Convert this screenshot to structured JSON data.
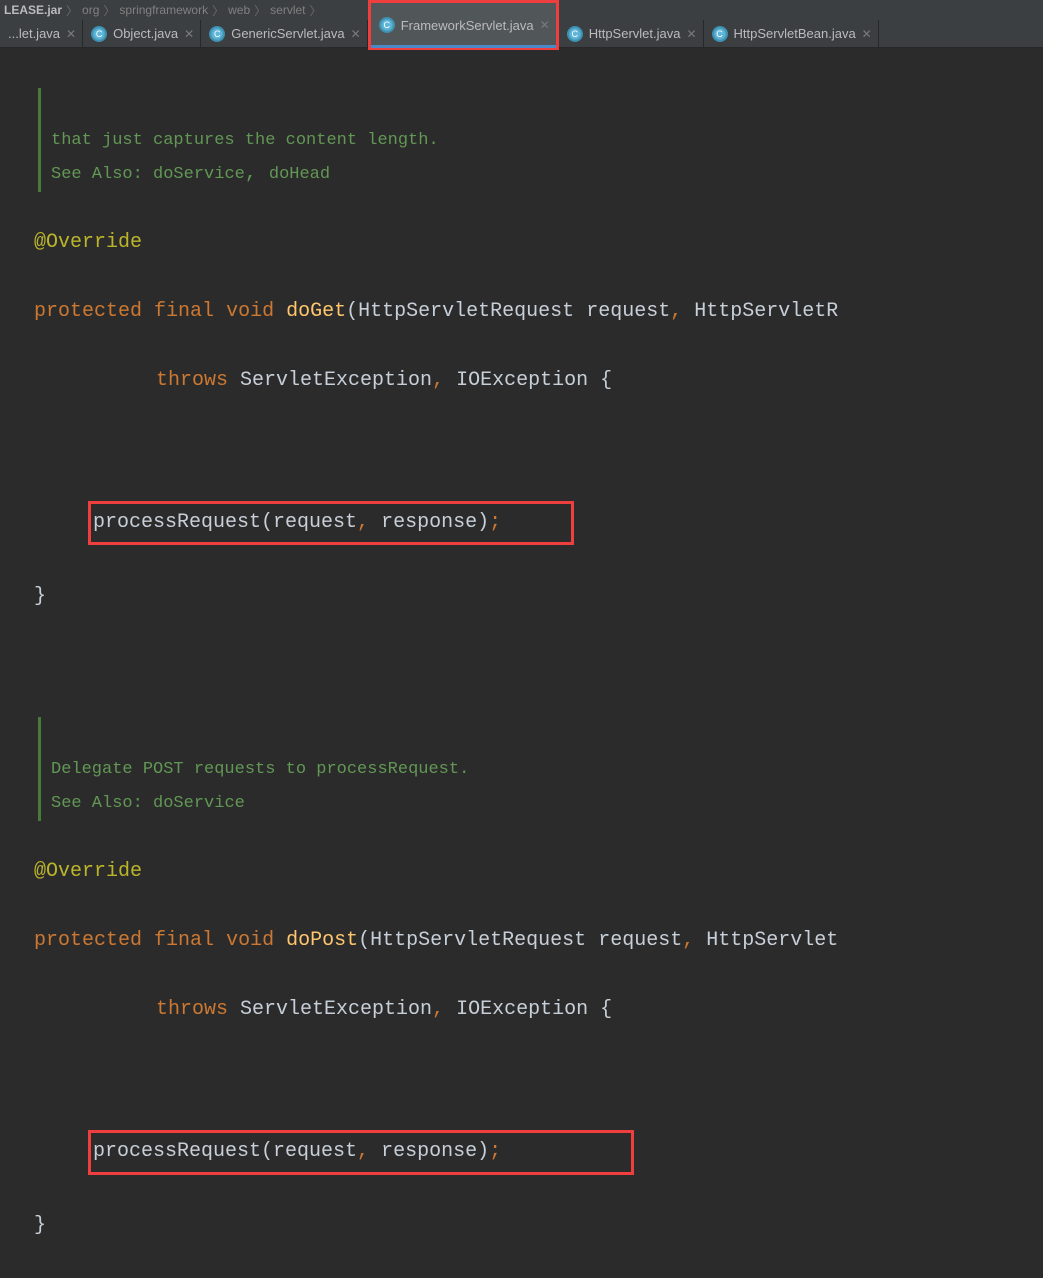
{
  "breadcrumb": {
    "items": [
      "LEASE.jar",
      "org",
      "springframework",
      "web",
      "servlet"
    ]
  },
  "tabs": [
    {
      "label": "...let.java",
      "active": false
    },
    {
      "label": "Object.java",
      "active": false
    },
    {
      "label": "GenericServlet.java",
      "active": false
    },
    {
      "label": "FrameworkServlet.java",
      "active": true,
      "highlighted": true
    },
    {
      "label": "HttpServlet.java",
      "active": false
    },
    {
      "label": "HttpServletBean.java",
      "active": false
    }
  ],
  "code": {
    "doc1_line1": "that just captures the content length.",
    "doc1_see": "See Also: ",
    "doc1_link1": "doService",
    "doc1_sep": ", ",
    "doc1_link2": "doHead",
    "override": "@Override",
    "protected": "protected",
    "final": "final",
    "void": "void",
    "doGet": "doGet",
    "doPost": "doPost",
    "sig_open": "(",
    "param_type": "HttpServletRequest",
    "param1": " request",
    "comma": ",",
    "param_type2": "HttpServletR",
    "param_type2b": "HttpServlet",
    "throws": "throws",
    "exc1": " ServletException",
    "exc2": " IOException ",
    "brace_open": "{",
    "call": "processRequest(request",
    "call2": " response)",
    "semi": ";",
    "brace_close": "}",
    "doc2_line1a": "Delegate POST requests to ",
    "doc2_link0": "processRequest",
    "doc2_dot": ".",
    "doc2_see": "See Also: ",
    "doc2_link1": "doService"
  }
}
